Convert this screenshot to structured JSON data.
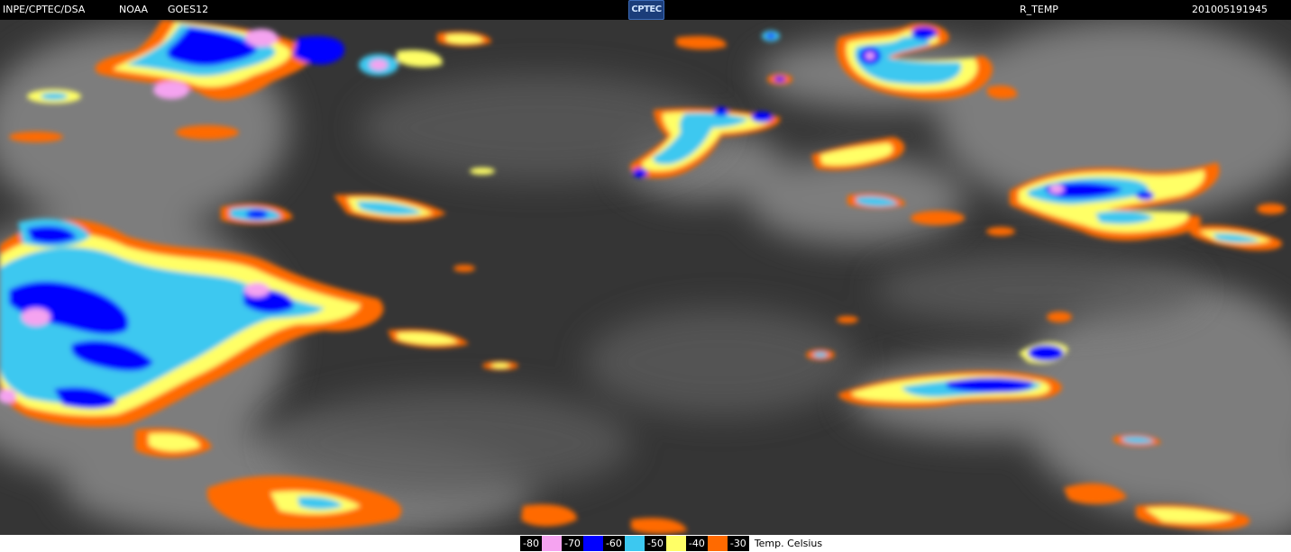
{
  "header": {
    "source": "INPE/CPTEC/DSA",
    "agency": "NOAA",
    "satellite": "GOES12",
    "logo_text": "CPTEC",
    "product": "R_TEMP",
    "timestamp": "201005191945"
  },
  "legend": {
    "entries": [
      {
        "label": "-80",
        "color": "#f5a3f0"
      },
      {
        "label": "-70",
        "color": "#0000ff"
      },
      {
        "label": "-60",
        "color": "#3cc8f0"
      },
      {
        "label": "-50",
        "color": "#ffff66"
      },
      {
        "label": "-40",
        "color": "#ff6a00"
      },
      {
        "label": "-30",
        "color": "#000000"
      }
    ],
    "unit": "Temp. Celsius"
  }
}
